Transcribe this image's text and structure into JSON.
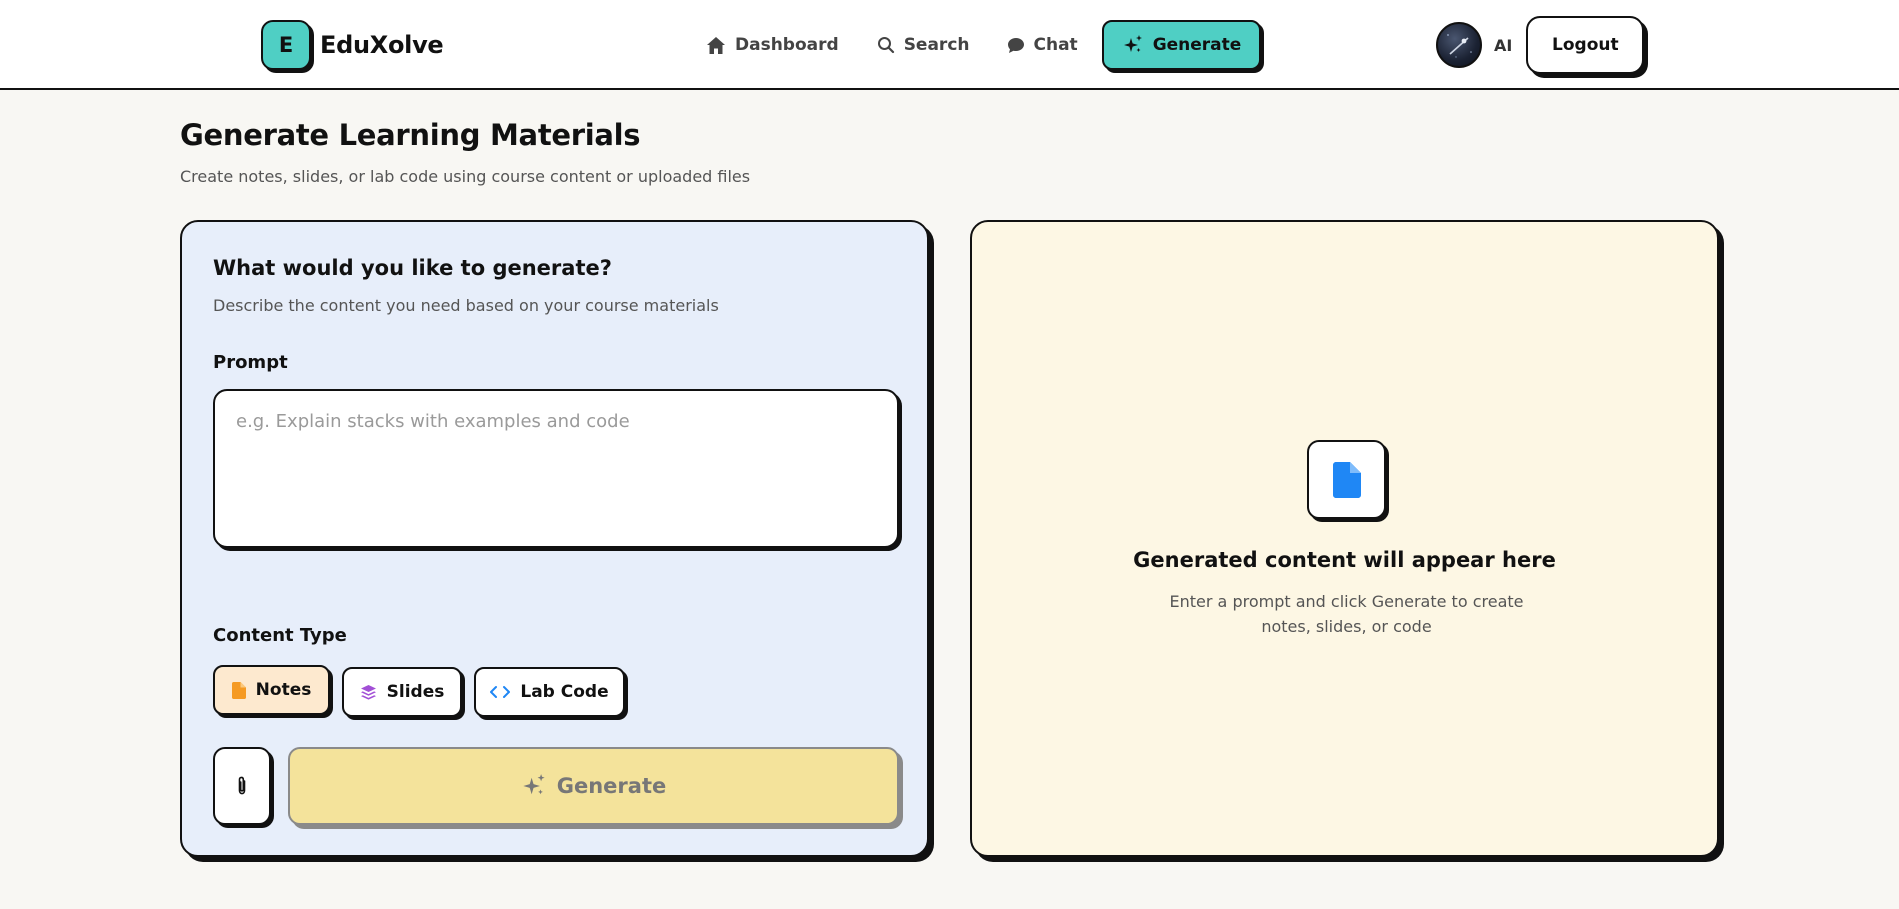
{
  "brand": {
    "logo_letter": "E",
    "name": "EduXolve"
  },
  "nav": {
    "items": [
      {
        "label": "Dashboard",
        "icon": "home-icon"
      },
      {
        "label": "Search",
        "icon": "search-icon"
      },
      {
        "label": "Chat",
        "icon": "chat-bubble-icon"
      },
      {
        "label": "Generate",
        "icon": "sparkles-icon",
        "active": true
      }
    ]
  },
  "user": {
    "avatar_icon": "avatar-image",
    "name": "AI",
    "logout_label": "Logout"
  },
  "page": {
    "title": "Generate Learning Materials",
    "subtitle": "Create notes, slides, or lab code using course content or uploaded files"
  },
  "form": {
    "heading": "What would you like to generate?",
    "description": "Describe the content you need based on your course materials",
    "prompt_label": "Prompt",
    "prompt_value": "",
    "prompt_placeholder": "e.g. Explain stacks with examples and code",
    "content_type_label": "Content Type",
    "content_types": [
      {
        "label": "Notes",
        "icon": "document-icon",
        "selected": true
      },
      {
        "label": "Slides",
        "icon": "layers-icon",
        "selected": false
      },
      {
        "label": "Lab Code",
        "icon": "code-icon",
        "selected": false
      }
    ],
    "attach_icon": "paperclip-icon",
    "generate_label": "Generate"
  },
  "output": {
    "icon": "document-icon",
    "empty_title": "Generated content will appear here",
    "empty_description": "Enter a prompt and click Generate to create notes, slides, or code"
  },
  "colors": {
    "accent_teal": "#4fcfc4",
    "left_panel_bg": "#e7eefa",
    "right_panel_bg": "#fdf7e4",
    "notes_selected_bg": "#fde9cf",
    "generate_disabled_bg": "#f4e39b",
    "doc_icon_blue": "#1f87f5",
    "notes_icon_orange": "#f59a23",
    "slides_icon_purple": "#a24fd6",
    "code_icon_blue": "#1f87f5"
  }
}
